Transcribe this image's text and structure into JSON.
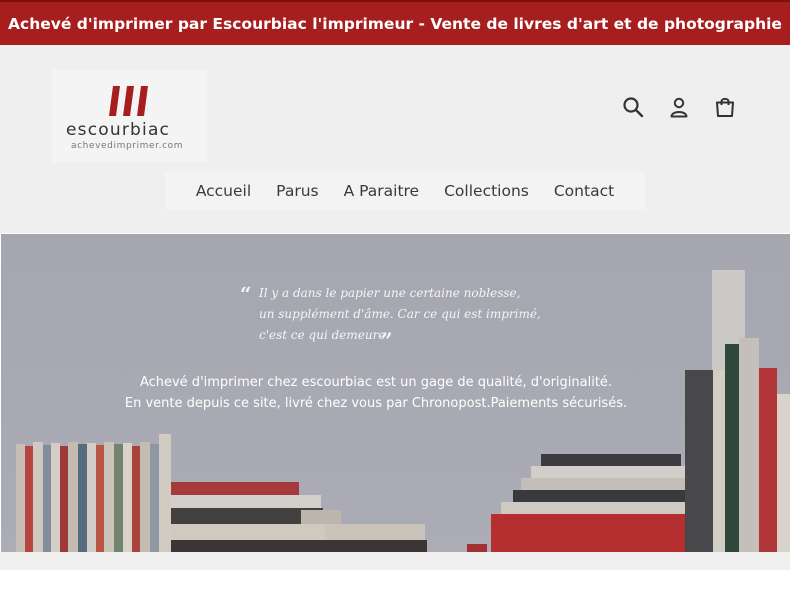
{
  "announcement": "Achevé d'imprimer par Escourbiac l'imprimeur - Vente de livres d'art et de photographie",
  "logo": {
    "name": "escourbiac",
    "domain": "achevedimprimer.com"
  },
  "header_icons": [
    "search-icon",
    "user-icon",
    "cart-icon"
  ],
  "nav": [
    "Accueil",
    "Parus",
    "A Paraitre",
    "Collections",
    "Contact"
  ],
  "hero": {
    "quote_lines": [
      "Il y a dans le papier une certaine noblesse,",
      "un supplément d'âme. Car ce qui est imprimé,",
      "c'est ce qui demeure."
    ],
    "tagline_lines": [
      "Achevé d'imprimer chez escourbiac est un gage de qualité, d'originalité.",
      "En vente depuis ce site, livré chez vous par Chronopost.Paiements sécurisés."
    ]
  },
  "colors": {
    "brand_red": "#a61e1e",
    "header_bg": "#efefef",
    "nav_text": "#3a3a3a"
  }
}
